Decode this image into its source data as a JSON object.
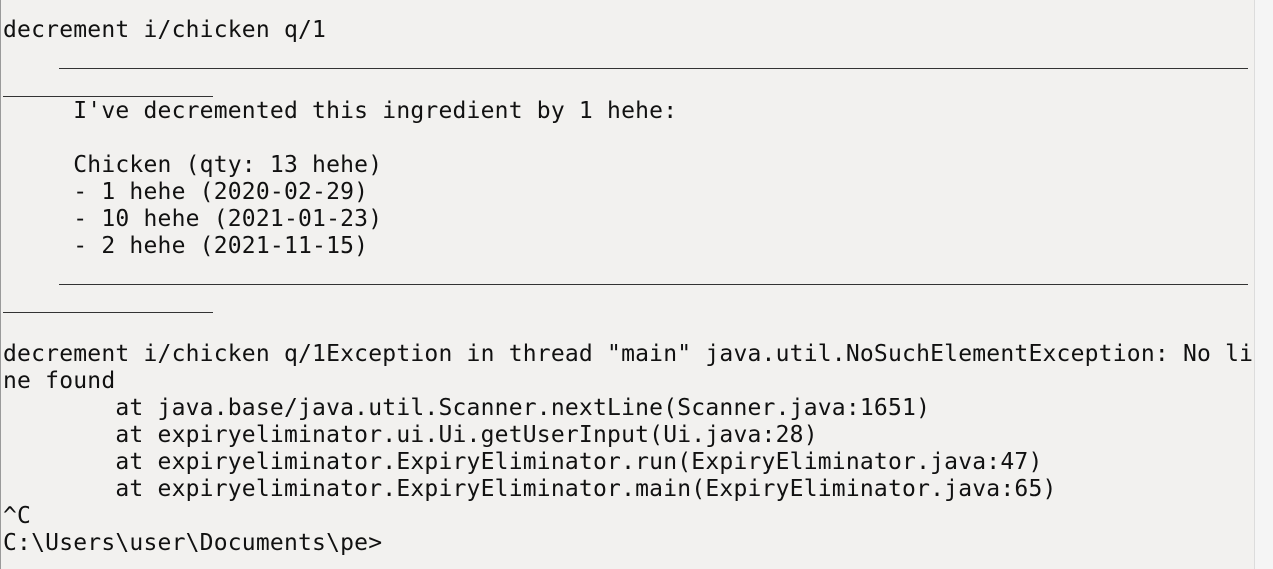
{
  "console": {
    "lines": [
      "decrement i/chicken q/1",
      "     I've decremented this ingredient by 1 hehe:",
      "",
      "     Chicken (qty: 13 hehe)",
      "     - 1 hehe (2020-02-29)",
      "     - 10 hehe (2021-01-23)",
      "     - 2 hehe (2021-11-15)",
      "decrement i/chicken q/1Exception in thread \"main\" java.util.NoSuchElementException: No li",
      "ne found",
      "        at java.base/java.util.Scanner.nextLine(Scanner.java:1651)",
      "        at expiryeliminator.ui.Ui.getUserInput(Ui.java:28)",
      "        at expiryeliminator.ExpiryEliminator.run(ExpiryEliminator.java:47)",
      "        at expiryeliminator.ExpiryEliminator.main(ExpiryEliminator.java:65)",
      "^C",
      "C:\\Users\\user\\Documents\\pe>"
    ]
  }
}
